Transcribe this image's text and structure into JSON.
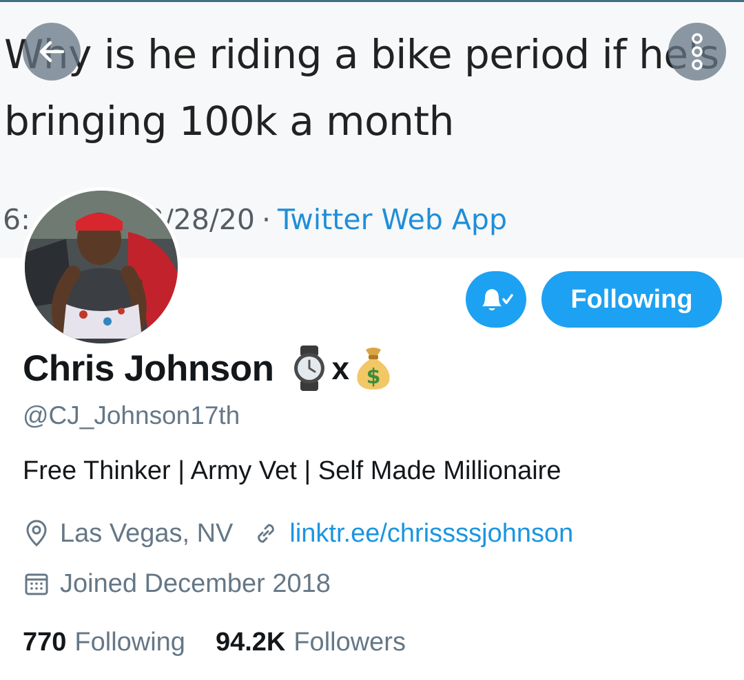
{
  "tweet": {
    "text": "Why is he riding a bike period if he's bringing 100k a month",
    "time_fragment": "6:",
    "date_fragment": "3/28/20",
    "separator": "·",
    "source": "Twitter Web App"
  },
  "nav": {
    "back_icon": "arrow-left-icon",
    "more_icon": "more-vertical-icon"
  },
  "actions": {
    "notifications_icon": "bell-check-icon",
    "following_label": "Following"
  },
  "profile": {
    "display_name": "Chris Johnson",
    "name_emoji": [
      "watch-emoji",
      "money-bag-emoji"
    ],
    "name_separator": "x",
    "handle": "@CJ_Johnson17th",
    "bio": "Free Thinker | Army Vet | Self Made Millionaire",
    "location": "Las Vegas, NV",
    "link": "linktr.ee/chrissssjohnson",
    "joined": "Joined December 2018"
  },
  "stats": {
    "following_count": "770",
    "following_label": "Following",
    "followers_count": "94.2K",
    "followers_label": "Followers"
  },
  "colors": {
    "accent": "#1da1f2",
    "link": "#1b95e0",
    "secondary_text": "#657786",
    "primary_text": "#14171a"
  }
}
